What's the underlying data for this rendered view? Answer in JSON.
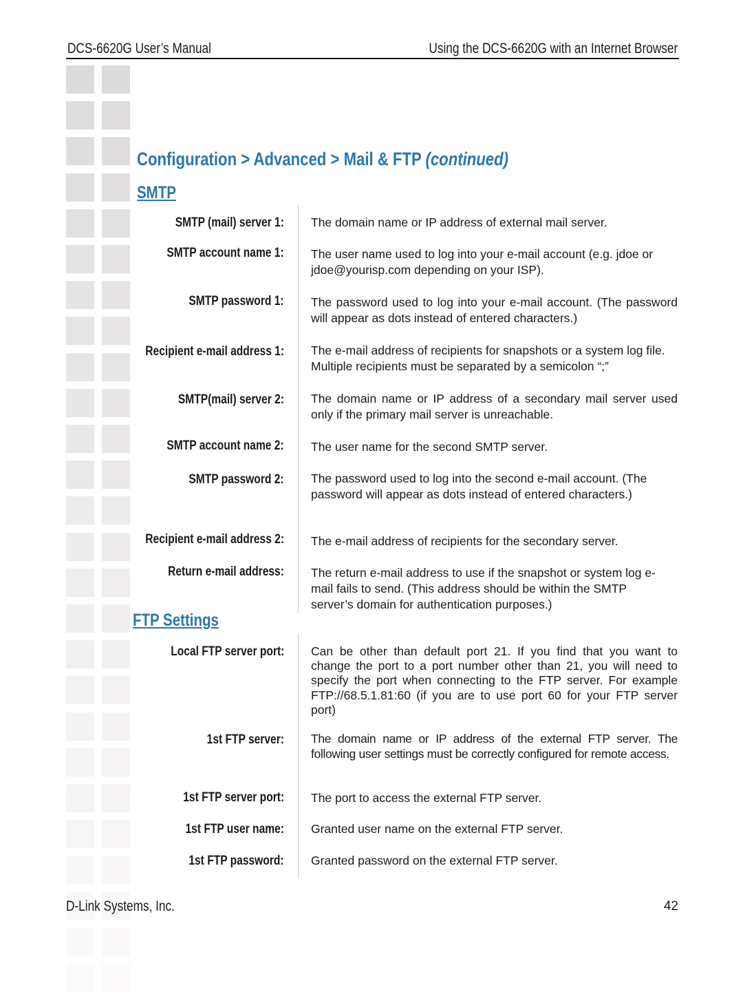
{
  "header": {
    "left": "DCS-6620G User’s Manual",
    "right": "Using the DCS-6620G with an Internet Browser"
  },
  "title": {
    "main": "Configuration > Advanced > Mail & FTP",
    "suffix": "(continued)"
  },
  "colors": {
    "accent": "#2a77ad",
    "text": "#1a1a1a",
    "divider": "#c8c8c8",
    "decor_square_top": "#dcdada"
  },
  "smtp": {
    "heading": "SMTP",
    "items": [
      {
        "label": "SMTP (mail) server 1:",
        "desc": "The domain name or IP address of external mail server."
      },
      {
        "label": "SMTP account name 1:",
        "desc": "The user name used to log into your e-mail account (e.g. jdoe or jdoe@yourisp.com depending on your ISP)."
      },
      {
        "label": "SMTP password 1:",
        "desc": "The password used to log into your e-mail account. (The password will appear as dots instead of entered characters.)"
      },
      {
        "label": "Recipient e-mail address 1:",
        "desc": "The e-mail address of recipients for snapshots or a system log file. Multiple recipients must be separated by a semicolon “;”"
      },
      {
        "label": "SMTP(mail) server 2:",
        "desc": "The domain name or IP address of a secondary mail server used only if the primary mail server is unreachable."
      },
      {
        "label": "SMTP account name 2:",
        "desc": "The user name for the second SMTP server."
      },
      {
        "label": "SMTP password 2:",
        "desc": "The password used to log into the second e-mail account. (The password will appear as dots instead of entered characters.)"
      },
      {
        "label": "Recipient e-mail address 2:",
        "desc": "The e-mail address of recipients for the secondary server."
      },
      {
        "label": "Return e-mail address:",
        "desc": "The return e-mail address to use if the snapshot or system log e-mail fails to send. (This address should be within the SMTP server’s domain for authentication purposes.)"
      }
    ]
  },
  "ftp": {
    "heading": "FTP Settings",
    "items": [
      {
        "label": "Local FTP server port:",
        "desc": "Can be other than default port 21. If you find that you want to change the port to a port number  other than 21, you will need to specify the port when connecting to the FTP server. For example FTP://68.5.1.81:60 (if you are to use port 60 for your FTP server port)"
      },
      {
        "label": "1st FTP server:",
        "desc": "The domain name or IP address of the external FTP server. The following user settings must be correctly configured for remote access."
      },
      {
        "label": "1st FTP server port:",
        "desc": "The port to access the external FTP server."
      },
      {
        "label": "1st FTP user name:",
        "desc": "Granted user name on the external FTP server."
      },
      {
        "label": "1st FTP password:",
        "desc": "Granted password on the external FTP server."
      }
    ]
  },
  "footer": {
    "company": "D-Link Systems, Inc.",
    "page_number": "42"
  }
}
